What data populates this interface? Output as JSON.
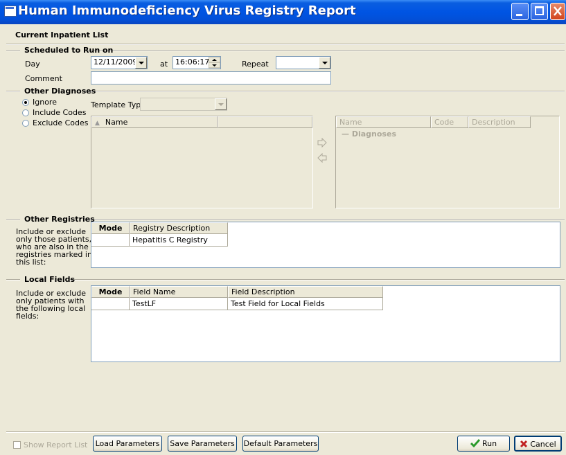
{
  "window": {
    "title": "Human Immunodeficiency Virus Registry Report"
  },
  "report_name": "Current Inpatient List",
  "schedule": {
    "section_label": "Scheduled to Run on",
    "day_label": "Day",
    "day_value": "12/11/2009",
    "at_label": "at",
    "time_value": "16:06:17",
    "repeat_label": "Repeat",
    "repeat_value": "",
    "comment_label": "Comment",
    "comment_value": ""
  },
  "other_diagnoses": {
    "section_label": "Other Diagnoses",
    "options": [
      "Ignore",
      "Include Codes",
      "Exclude Codes"
    ],
    "selected": "Ignore",
    "template_type_label": "Template Type",
    "template_type_value": "",
    "left_list_headers": [
      "Name",
      ""
    ],
    "right_list_headers": [
      "Name",
      "Code",
      "Description"
    ],
    "right_list_group": "Diagnoses",
    "add_icon": "arrow-right-icon",
    "remove_icon": "arrow-left-icon"
  },
  "other_registries": {
    "section_label": "Other Registries",
    "help_lines": [
      "Include or exclude",
      "only those patients,",
      "who are also in the",
      "registries marked in",
      "this list:"
    ],
    "headers": [
      "Mode",
      "Registry Description"
    ],
    "rows": [
      {
        "mode": "",
        "description": "Hepatitis C Registry"
      }
    ]
  },
  "local_fields": {
    "section_label": "Local Fields",
    "help_lines": [
      "Include or exclude",
      "only patients with",
      "the following local",
      "fields:"
    ],
    "headers": [
      "Mode",
      "Field Name",
      "Field Description"
    ],
    "rows": [
      {
        "mode": "",
        "name": "TestLF",
        "description": "Test Field for Local Fields"
      }
    ]
  },
  "footer": {
    "show_report_list": "Show Report List",
    "load_parameters": "Load Parameters",
    "save_parameters": "Save Parameters",
    "default_parameters": "Default Parameters",
    "run": "Run",
    "cancel": "Cancel"
  },
  "colors": {
    "titlebar": "#0054e3",
    "face": "#ece9d8",
    "border": "#7f9db9"
  }
}
